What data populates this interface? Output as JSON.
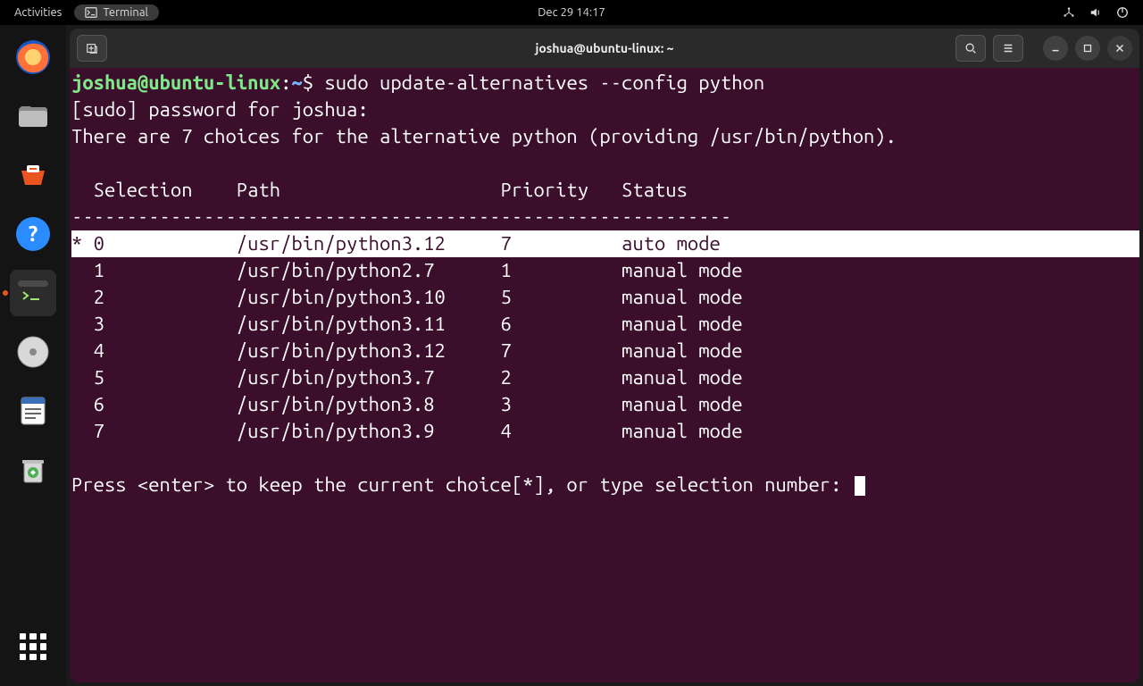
{
  "topbar": {
    "activities": "Activities",
    "app_label": "Terminal",
    "clock": "Dec 29  14:17"
  },
  "dock_items": [
    "firefox",
    "files",
    "software",
    "help",
    "terminal",
    "disks",
    "text-editor",
    "trash"
  ],
  "window": {
    "title": "joshua@ubuntu-linux: ~"
  },
  "prompt": {
    "user_host": "joshua@ubuntu-linux",
    "cwd": "~",
    "separator": ":",
    "dollar": "$",
    "command": "sudo update-alternatives --config python"
  },
  "lines": {
    "sudo_pw": "[sudo] password for joshua: ",
    "choices_intro": "There are 7 choices for the alternative python (providing /usr/bin/python).",
    "header": "  Selection    Path                    Priority   Status",
    "divider": "------------------------------------------------------------",
    "footer": "Press <enter> to keep the current choice[*], or type selection number: "
  },
  "alternatives": [
    {
      "mark": "*",
      "sel": "0",
      "path": "/usr/bin/python3.12",
      "prio": "7",
      "status": "auto mode",
      "highlighted": true
    },
    {
      "mark": " ",
      "sel": "1",
      "path": "/usr/bin/python2.7",
      "prio": "1",
      "status": "manual mode",
      "highlighted": false
    },
    {
      "mark": " ",
      "sel": "2",
      "path": "/usr/bin/python3.10",
      "prio": "5",
      "status": "manual mode",
      "highlighted": false
    },
    {
      "mark": " ",
      "sel": "3",
      "path": "/usr/bin/python3.11",
      "prio": "6",
      "status": "manual mode",
      "highlighted": false
    },
    {
      "mark": " ",
      "sel": "4",
      "path": "/usr/bin/python3.12",
      "prio": "7",
      "status": "manual mode",
      "highlighted": false
    },
    {
      "mark": " ",
      "sel": "5",
      "path": "/usr/bin/python3.7",
      "prio": "2",
      "status": "manual mode",
      "highlighted": false
    },
    {
      "mark": " ",
      "sel": "6",
      "path": "/usr/bin/python3.8",
      "prio": "3",
      "status": "manual mode",
      "highlighted": false
    },
    {
      "mark": " ",
      "sel": "7",
      "path": "/usr/bin/python3.9",
      "prio": "4",
      "status": "manual mode",
      "highlighted": false
    }
  ],
  "col_widths": {
    "mark": 1,
    "sel": 13,
    "path": 24,
    "prio": 11
  }
}
